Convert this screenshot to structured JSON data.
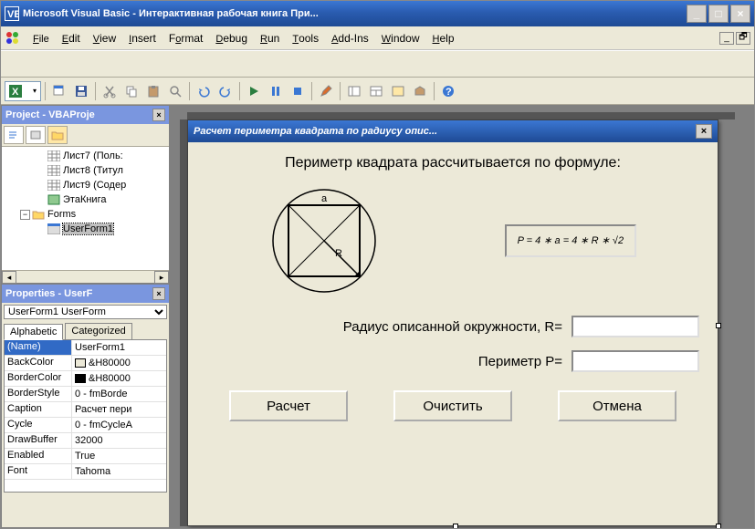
{
  "title": "Microsoft Visual Basic - Интерактивная рабочая книга При...",
  "menu": {
    "items": [
      "File",
      "Edit",
      "View",
      "Insert",
      "Format",
      "Debug",
      "Run",
      "Tools",
      "Add-Ins",
      "Window",
      "Help"
    ]
  },
  "project_panel": {
    "title": "Project - VBAProje",
    "tree": [
      {
        "indent": 48,
        "icon": "sheet",
        "label": "Лист7 (Поль:"
      },
      {
        "indent": 48,
        "icon": "sheet",
        "label": "Лист8 (Титул"
      },
      {
        "indent": 48,
        "icon": "sheet",
        "label": "Лист9 (Содер"
      },
      {
        "indent": 48,
        "icon": "book",
        "label": "ЭтаКнига"
      },
      {
        "indent": 18,
        "icon": "folder",
        "expand": "-",
        "label": "Forms"
      },
      {
        "indent": 48,
        "icon": "form",
        "label": "UserForm1",
        "selected": true
      }
    ]
  },
  "props_panel": {
    "title": "Properties - UserF",
    "combo": "UserForm1 UserForm",
    "tabs": {
      "a": "Alphabetic",
      "b": "Categorized"
    },
    "rows": [
      {
        "name": "(Name)",
        "val": "UserForm1",
        "sel": true
      },
      {
        "name": "BackColor",
        "val": "&H80000",
        "color": "#ece9d8"
      },
      {
        "name": "BorderColor",
        "val": "&H80000",
        "color": "#000000"
      },
      {
        "name": "BorderStyle",
        "val": "0 - fmBorde"
      },
      {
        "name": "Caption",
        "val": "Расчет пери"
      },
      {
        "name": "Cycle",
        "val": "0 - fmCycleA"
      },
      {
        "name": "DrawBuffer",
        "val": "32000"
      },
      {
        "name": "Enabled",
        "val": "True"
      },
      {
        "name": "Font",
        "val": "Tahoma"
      }
    ]
  },
  "userform": {
    "title": "Расчет периметра квадрата по радиусу опис...",
    "heading": "Периметр квадрата рассчитывается по формуле:",
    "diagram": {
      "top_label": "a",
      "r_label": "R"
    },
    "formula": "P = 4 ∗ a = 4 ∗ R ∗ √2",
    "field_r": "Радиус описанной окружности, R=",
    "field_p": "Периметр P=",
    "val_r": "",
    "val_p": "",
    "btn_calc": "Расчет",
    "btn_clear": "Очистить",
    "btn_cancel": "Отмена"
  }
}
